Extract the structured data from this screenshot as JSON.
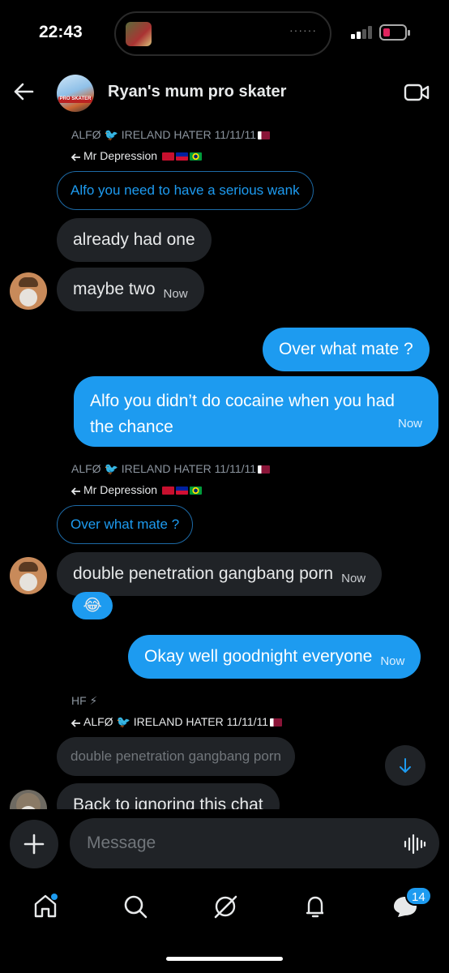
{
  "status_bar": {
    "time": "22:43",
    "island_dots": "······",
    "battery_color": "#e0245e"
  },
  "header": {
    "title": "Ryan's mum pro skater",
    "group_avatar_label": "PRO SKATER"
  },
  "messages": [
    {
      "id": "m1",
      "sender": "ALFØ 🐦 IRELAND HATER 11/11/11",
      "reply_to": "Mr Depression",
      "quote": "Alfo you need to have a serious wank"
    },
    {
      "id": "m2",
      "text": "already had one"
    },
    {
      "id": "m3",
      "text": "maybe two",
      "time": "Now"
    },
    {
      "id": "m4",
      "text": "Over what mate ?"
    },
    {
      "id": "m5",
      "text_line1": "Alfo you didn’t do cocaine when you had",
      "text_line2": "the chance",
      "time": "Now"
    },
    {
      "id": "m6",
      "sender": "ALFØ 🐦 IRELAND HATER 11/11/11",
      "reply_to": "Mr Depression",
      "quote": "Over what mate ?"
    },
    {
      "id": "m7",
      "text": "double penetration gangbang porn",
      "time": "Now",
      "reaction": "😂"
    },
    {
      "id": "m8",
      "text": "Okay well goodnight everyone",
      "time": "Now"
    },
    {
      "id": "m9",
      "sender": "HF ⚡",
      "reply_to": "ALFØ 🐦 IRELAND HATER 11/11/11",
      "quote": "double penetration gangbang porn"
    },
    {
      "id": "m10",
      "text": "Back to ignoring this chat"
    }
  ],
  "composer": {
    "placeholder": "Message"
  },
  "nav": {
    "items": [
      "home-icon",
      "search-icon",
      "grok-icon",
      "notifications-icon",
      "messages-icon"
    ],
    "messages_badge": "14"
  },
  "colors": {
    "accent": "#1d9bf0",
    "bubble_in": "#202327",
    "background": "#000000"
  }
}
